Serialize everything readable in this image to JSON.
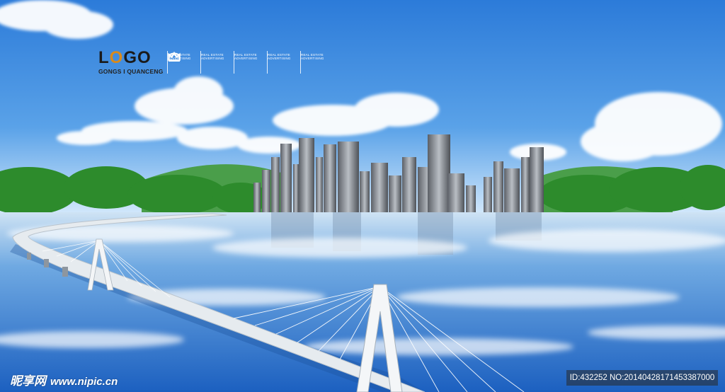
{
  "scene": {
    "colors": {
      "sky_top": "#2f7fdc",
      "sky_bottom": "#cfe6fb",
      "water_top": "#bcd9f2",
      "water_bottom": "#1d63c2",
      "hills": "#3f9a43",
      "trees": "#2f8a2e",
      "buildings": "#6c7178",
      "bridge": "#e9eef2"
    },
    "elements": [
      "sky",
      "clouds",
      "hills",
      "trees",
      "city-skyline",
      "lake",
      "cable-stayed-bridge"
    ]
  },
  "logo": {
    "title_a": "L",
    "title_o": "O",
    "title_b": "GO",
    "subtitle": "GONGS I QUANCENG"
  },
  "crowns": [
    {
      "icon": "crown-icon",
      "caption": "REAL ESTATE ADVERTISING"
    },
    {
      "icon": "crown-icon",
      "caption": "REAL ESTATE ADVERTISING"
    },
    {
      "icon": "crown-icon",
      "caption": "REAL ESTATE ADVERTISING"
    },
    {
      "icon": "crown-icon",
      "caption": "REAL ESTATE ADVERTISING"
    },
    {
      "icon": "crown-icon",
      "caption": "REAL ESTATE ADVERTISING"
    }
  ],
  "watermark": {
    "site_cn": "昵享网",
    "url": "www.nipic.cn",
    "id_text": "ID:432252 NO:20140428171453387000"
  }
}
